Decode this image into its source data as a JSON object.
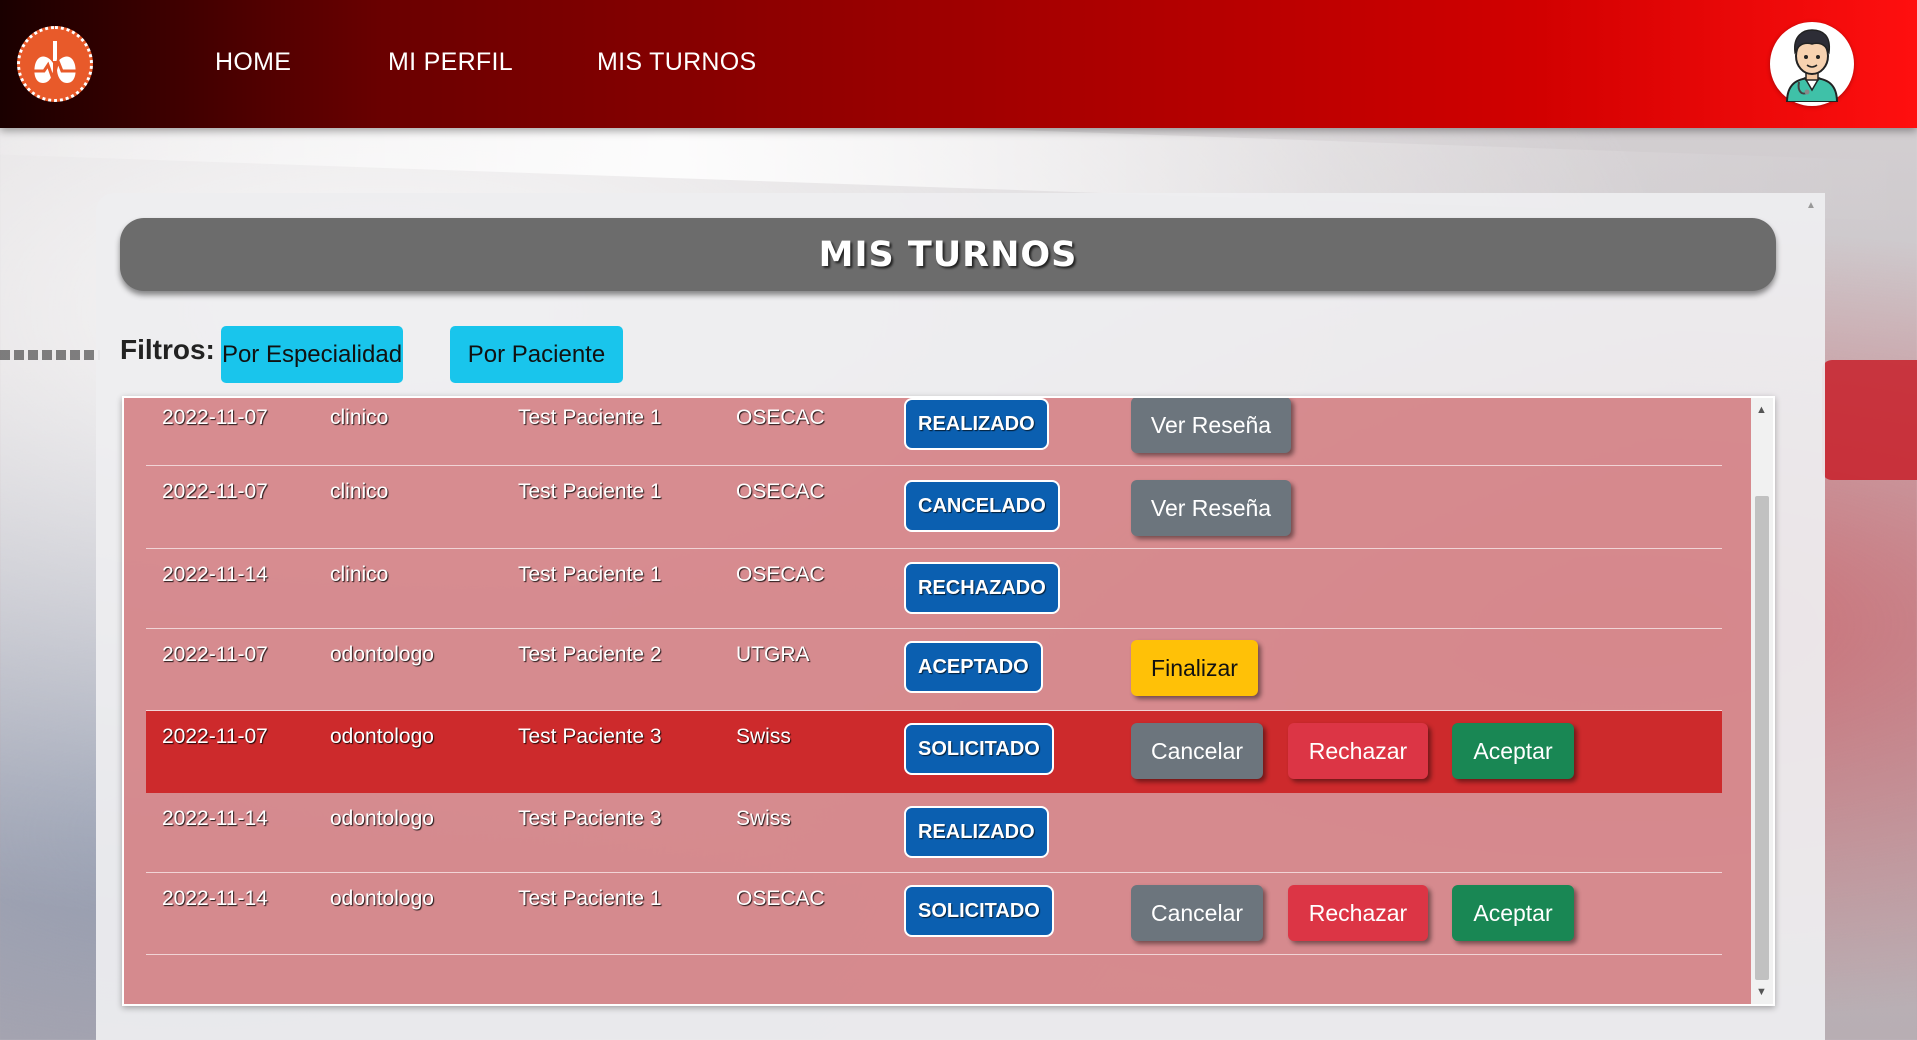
{
  "nav": {
    "links": [
      "HOME",
      "MI PERFIL",
      "MIS TURNOS"
    ]
  },
  "page": {
    "title": "MIS TURNOS",
    "filters_label": "Filtros:",
    "filters": [
      "Por Especialidad",
      "Por Paciente"
    ]
  },
  "rows": [
    {
      "fecha": "2022-11-07",
      "especialidad": "clinico",
      "paciente": "Test Paciente 1",
      "obra_social": "OSECAC",
      "estado": "REALIZADO",
      "acciones": [
        "Ver Reseña"
      ]
    },
    {
      "fecha": "2022-11-07",
      "especialidad": "clinico",
      "paciente": "Test Paciente 1",
      "obra_social": "OSECAC",
      "estado": "CANCELADO",
      "acciones": [
        "Ver Reseña"
      ]
    },
    {
      "fecha": "2022-11-14",
      "especialidad": "clinico",
      "paciente": "Test Paciente 1",
      "obra_social": "OSECAC",
      "estado": "RECHAZADO",
      "acciones": []
    },
    {
      "fecha": "2022-11-07",
      "especialidad": "odontologo",
      "paciente": "Test Paciente 2",
      "obra_social": "UTGRA",
      "estado": "ACEPTADO",
      "acciones": [
        "Finalizar"
      ]
    },
    {
      "fecha": "2022-11-07",
      "especialidad": "odontologo",
      "paciente": "Test Paciente 3",
      "obra_social": "Swiss",
      "estado": "SOLICITADO",
      "acciones": [
        "Cancelar",
        "Rechazar",
        "Aceptar"
      ]
    },
    {
      "fecha": "2022-11-14",
      "especialidad": "odontologo",
      "paciente": "Test Paciente 3",
      "obra_social": "Swiss",
      "estado": "REALIZADO",
      "acciones": []
    },
    {
      "fecha": "2022-11-14",
      "especialidad": "odontologo",
      "paciente": "Test Paciente 1",
      "obra_social": "OSECAC",
      "estado": "SOLICITADO",
      "acciones": [
        "Cancelar",
        "Rechazar",
        "Aceptar"
      ]
    }
  ],
  "colors": {
    "nav_gradient_start": "#1a0000",
    "nav_gradient_end": "#ff0f0f",
    "filter_button": "#19c5ec",
    "status_badge": "#0b5fb0",
    "highlight_row": "#cd2a2c",
    "btn_gray": "#6c757d",
    "btn_red": "#dc3545",
    "btn_green": "#198754",
    "btn_yellow": "#ffc107"
  },
  "icons": {
    "logo": "lungs-heartbeat-logo",
    "avatar": "doctor-avatar-icon"
  }
}
